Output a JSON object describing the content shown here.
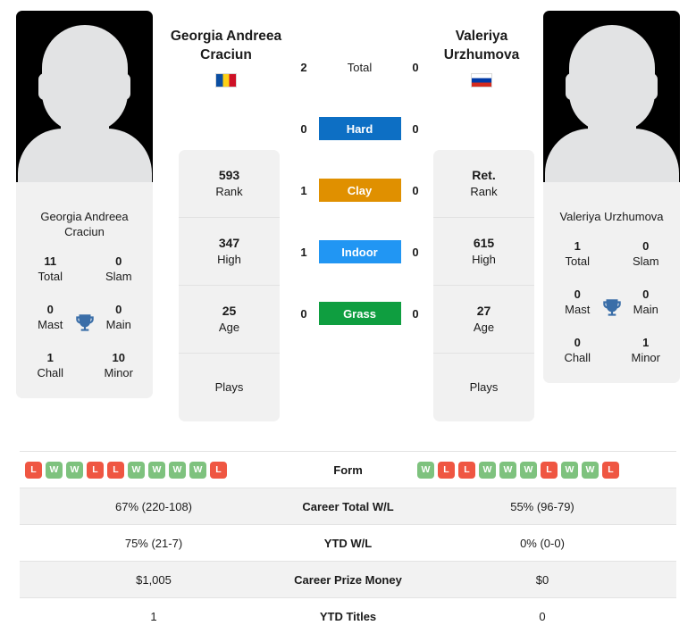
{
  "players": {
    "left": {
      "display_name_line1": "Georgia Andreea",
      "display_name_line2": "Craciun",
      "card_name": "Georgia Andreea Craciun",
      "flag": "ro-flag",
      "titles": {
        "total_value": "11",
        "total_label": "Total",
        "slam_value": "0",
        "slam_label": "Slam",
        "mast_value": "0",
        "mast_label": "Mast",
        "main_value": "0",
        "main_label": "Main",
        "chall_value": "1",
        "chall_label": "Chall",
        "minor_value": "10",
        "minor_label": "Minor"
      },
      "ranking": {
        "rank_value": "593",
        "rank_label": "Rank",
        "high_value": "347",
        "high_label": "High",
        "age_value": "25",
        "age_label": "Age",
        "plays_label": "Plays",
        "plays_value": ""
      },
      "form": [
        "L",
        "W",
        "W",
        "L",
        "L",
        "W",
        "W",
        "W",
        "W",
        "L"
      ],
      "career_total_wl": "67% (220-108)",
      "ytd_wl": "75% (21-7)",
      "career_prize_money": "$1,005",
      "ytd_titles": "1"
    },
    "right": {
      "display_name_line1": "Valeriya",
      "display_name_line2": "Urzhumova",
      "card_name": "Valeriya Urzhumova",
      "flag": "ru-flag",
      "titles": {
        "total_value": "1",
        "total_label": "Total",
        "slam_value": "0",
        "slam_label": "Slam",
        "mast_value": "0",
        "mast_label": "Mast",
        "main_value": "0",
        "main_label": "Main",
        "chall_value": "0",
        "chall_label": "Chall",
        "minor_value": "1",
        "minor_label": "Minor"
      },
      "ranking": {
        "rank_value": "Ret.",
        "rank_label": "Rank",
        "high_value": "615",
        "high_label": "High",
        "age_value": "27",
        "age_label": "Age",
        "plays_label": "Plays",
        "plays_value": ""
      },
      "form": [
        "W",
        "L",
        "L",
        "W",
        "W",
        "W",
        "L",
        "W",
        "W",
        "L"
      ],
      "career_total_wl": "55% (96-79)",
      "ytd_wl": "0% (0-0)",
      "career_prize_money": "$0",
      "ytd_titles": "0"
    }
  },
  "surfaces": [
    {
      "key": "total",
      "label": "Total",
      "left": "2",
      "right": "0",
      "color": "transparent"
    },
    {
      "key": "hard",
      "label": "Hard",
      "left": "0",
      "right": "0",
      "color": "#0d6fc4"
    },
    {
      "key": "clay",
      "label": "Clay",
      "left": "1",
      "right": "0",
      "color": "#e09000"
    },
    {
      "key": "indoor",
      "label": "Indoor",
      "left": "1",
      "right": "0",
      "color": "#2196f3"
    },
    {
      "key": "grass",
      "label": "Grass",
      "left": "0",
      "right": "0",
      "color": "#0f9e40"
    }
  ],
  "table": {
    "rows": [
      {
        "key": "form",
        "label": "Form"
      },
      {
        "key": "career_total_wl",
        "label": "Career Total W/L"
      },
      {
        "key": "ytd_wl",
        "label": "YTD W/L"
      },
      {
        "key": "career_prize_money",
        "label": "Career Prize Money"
      },
      {
        "key": "ytd_titles",
        "label": "YTD Titles"
      }
    ]
  },
  "colors": {
    "hard": "#0d6fc4",
    "clay": "#e09000",
    "indoor": "#2196f3",
    "grass": "#0f9e40",
    "win_badge": "#7ec27e",
    "loss_badge": "#ef5642",
    "trophy": "#3a6ea8",
    "card_bg": "#f1f1f1",
    "row_alt_bg": "#f2f2f2"
  }
}
